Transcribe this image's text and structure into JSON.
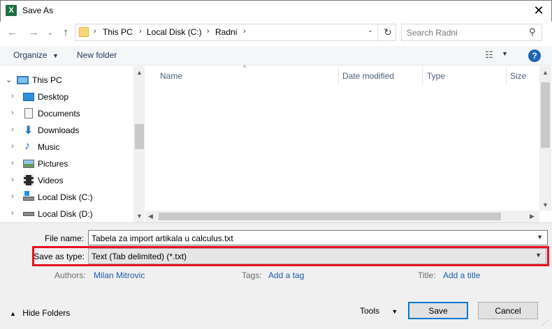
{
  "window": {
    "title": "Save As",
    "app_icon_letter": "X",
    "close_glyph": "✕"
  },
  "nav_buttons": {
    "back": "←",
    "forward": "→",
    "recent": "⌄",
    "up": "↑"
  },
  "address": {
    "crumbs": [
      "This PC",
      "Local Disk (C:)",
      "Radni"
    ],
    "separator": "›"
  },
  "search": {
    "placeholder": "Search Radni"
  },
  "toolbar": {
    "organize_label": "Organize",
    "new_folder_label": "New folder",
    "help_label": "?"
  },
  "navigation": {
    "items": [
      {
        "label": "This PC",
        "icon": "computer-icon",
        "expanded": true
      },
      {
        "label": "Desktop",
        "icon": "desktop-icon"
      },
      {
        "label": "Documents",
        "icon": "documents-icon"
      },
      {
        "label": "Downloads",
        "icon": "downloads-icon"
      },
      {
        "label": "Music",
        "icon": "music-icon"
      },
      {
        "label": "Pictures",
        "icon": "pictures-icon"
      },
      {
        "label": "Videos",
        "icon": "videos-icon"
      },
      {
        "label": "Local Disk (C:)",
        "icon": "windows-drive-icon"
      },
      {
        "label": "Local Disk (D:)",
        "icon": "drive-icon"
      }
    ]
  },
  "file_list": {
    "columns": [
      "Name",
      "Date modified",
      "Type",
      "Size"
    ]
  },
  "form": {
    "file_name_label": "File name:",
    "file_name_value": "Tabela za import artikala u calculus.txt",
    "save_type_label": "Save as type:",
    "save_type_value": "Text (Tab delimited) (*.txt)",
    "authors_label": "Authors:",
    "authors_value": "Milan Mitrovic",
    "tags_label": "Tags:",
    "tags_value": "Add a tag",
    "title_label": "Title:",
    "title_value": "Add a title"
  },
  "footer": {
    "hide_folders_label": "Hide Folders",
    "tools_label": "Tools",
    "save_label": "Save",
    "cancel_label": "Cancel"
  },
  "colors": {
    "highlight": "#e81123",
    "accent": "#0078d7",
    "link": "#1e5ba8"
  }
}
